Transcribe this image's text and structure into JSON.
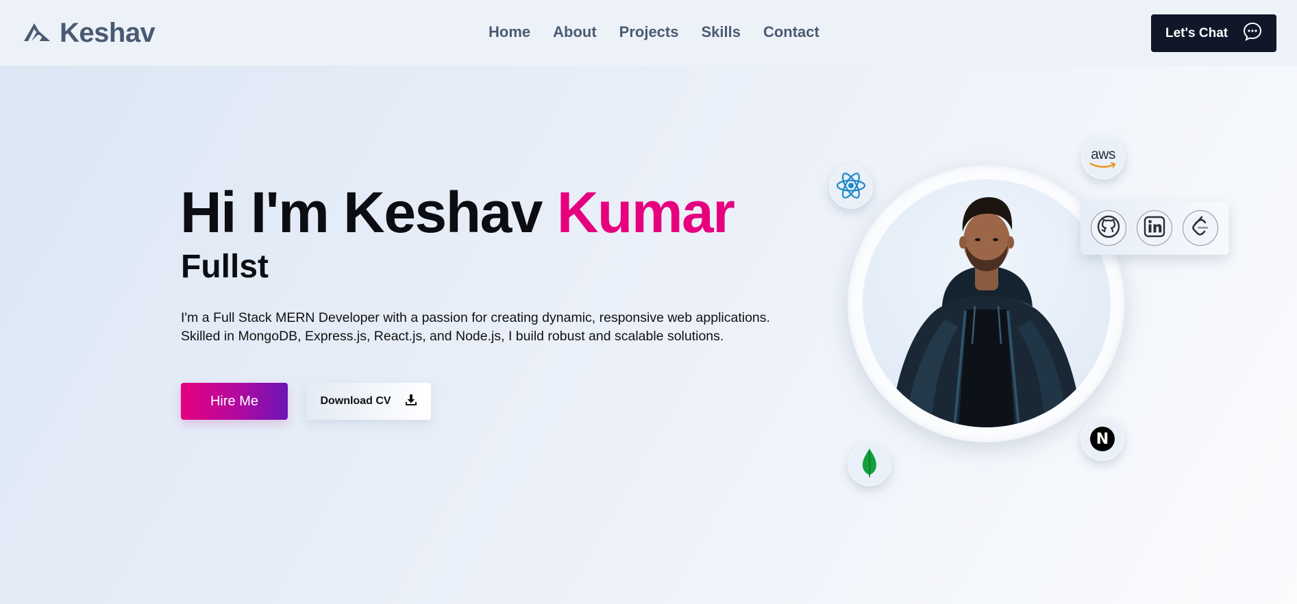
{
  "nav": {
    "logo_text": "Keshav",
    "links": [
      "Home",
      "About",
      "Projects",
      "Skills",
      "Contact"
    ],
    "chat_label": "Let's Chat"
  },
  "hero": {
    "title_part1": "Hi I'm Keshav ",
    "title_part2": "Kumar",
    "subtitle": "Fullst",
    "description": "I'm a Full Stack MERN Developer with a passion for creating dynamic, responsive web applications. Skilled in MongoDB, Express.js, React.js, and Node.js, I build robust and scalable solutions.",
    "hire_label": "Hire Me",
    "cv_label": "Download CV"
  },
  "badges": {
    "aws_label": "aws",
    "next_label": "N"
  },
  "colors": {
    "accent": "#e6007e",
    "dark_button": "#0f1729",
    "nav_text": "#4a5a72",
    "gradient_end": "#6a14b4"
  },
  "icons": [
    "logo-mountain-icon",
    "chat-bubble-icon",
    "download-icon",
    "react-icon",
    "aws-icon",
    "github-icon",
    "linkedin-icon",
    "leetcode-icon",
    "nextjs-icon",
    "mongodb-icon"
  ]
}
